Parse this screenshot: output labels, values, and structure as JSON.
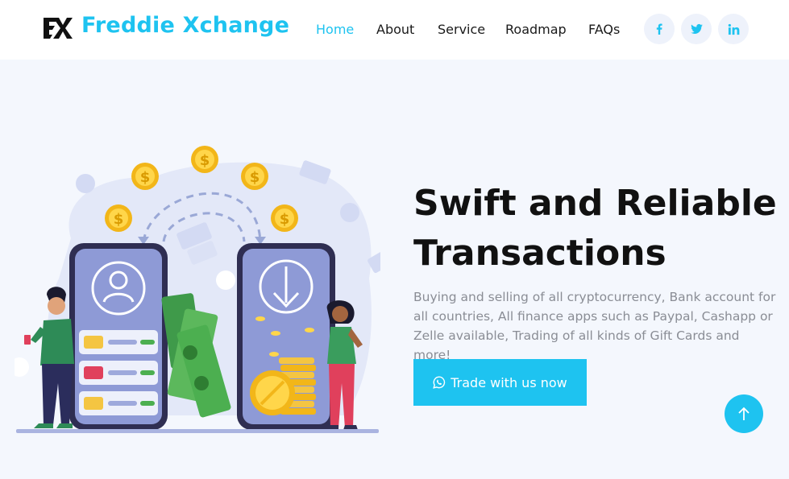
{
  "brand": {
    "name": "Freddie Xchange",
    "logo_icon": "fx-logo-icon",
    "accent_color": "#1ec3f0"
  },
  "nav": {
    "items": [
      {
        "label": "Home",
        "active": true
      },
      {
        "label": "About",
        "active": false
      },
      {
        "label": "Service",
        "active": false
      },
      {
        "label": "Roadmap",
        "active": false
      },
      {
        "label": "FAQs",
        "active": false
      }
    ]
  },
  "social": [
    {
      "icon": "facebook-icon"
    },
    {
      "icon": "twitter-icon"
    },
    {
      "icon": "linkedin-icon"
    }
  ],
  "hero": {
    "headline_line1": "Swift and Reliable",
    "headline_line2": "Transactions",
    "description": "Buying and selling of all cryptocurrency, Bank account for all countries, All finance apps such as Paypal, Cashapp or Zelle available, Trading of all kinds of Gift Cards and more!",
    "cta_label": "Trade with us now",
    "cta_icon": "whatsapp-icon",
    "illustration_coin_symbol": "$"
  },
  "scroll_top": {
    "icon": "arrow-up-icon"
  }
}
